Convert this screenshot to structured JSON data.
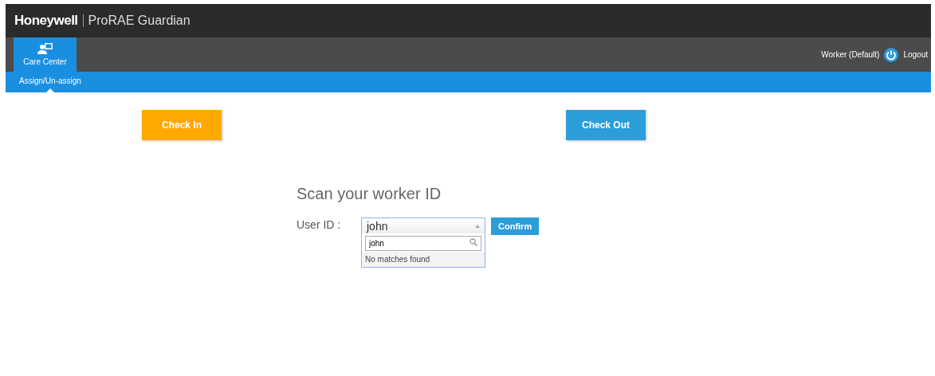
{
  "header": {
    "brand": "Honeywell",
    "product": "ProRAE Guardian"
  },
  "nav": {
    "tabs": [
      {
        "label": "Care Center",
        "selected": true
      }
    ],
    "user": "Worker (Default)",
    "logout": "Logout"
  },
  "subnav": {
    "items": [
      {
        "label": "Assign/Un-assign",
        "selected": true
      }
    ]
  },
  "actions": [
    {
      "label": "Check In",
      "kind": "checkin"
    },
    {
      "label": "Check Out",
      "kind": "checkout"
    }
  ],
  "form": {
    "title": "Scan your worker ID",
    "label": "User ID :",
    "select": {
      "value": "john",
      "expanded": true,
      "search": "john",
      "message": "No matches found"
    },
    "confirm": "Confirm"
  }
}
